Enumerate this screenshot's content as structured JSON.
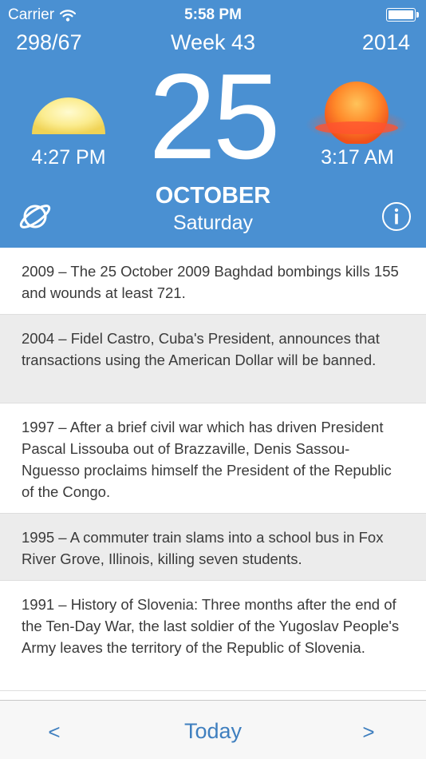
{
  "status_bar": {
    "carrier": "Carrier",
    "time": "5:58 PM",
    "icons": [
      "wifi-icon",
      "battery-icon"
    ]
  },
  "header": {
    "day_stat": "298/67",
    "week": "Week 43",
    "year": "2014",
    "day": "25",
    "month": "OCTOBER",
    "weekday": "Saturday",
    "sunrise_time": "4:27 PM",
    "sunset_time": "3:17 AM",
    "icons": [
      "sunrise-icon",
      "sunset-icon",
      "planet-icon",
      "info-icon"
    ]
  },
  "events": [
    "2009 – The 25 October 2009 Baghdad bombings kills 155 and wounds at least 721.",
    "2004 – Fidel Castro, Cuba's President, announces that transactions using the American Dollar will be banned.",
    "1997 – After a brief civil war which has driven President Pascal Lissouba out of Brazzaville, Denis Sassou-Nguesso proclaims himself the President of the Republic of the Congo.",
    "1995 – A commuter train slams into a school bus in Fox River Grove, Illinois, killing seven students.",
    "1991 – History of Slovenia: Three months after the end of the Ten-Day War, the last soldier of the Yugoslav People's Army leaves the territory of the Republic of Slovenia."
  ],
  "bottom_bar": {
    "prev_label": "<",
    "today_label": "Today",
    "next_label": ">"
  },
  "colors": {
    "header_background": "#4a90d2",
    "accent": "#3f7fbf",
    "shaded_row": "#ececec"
  }
}
